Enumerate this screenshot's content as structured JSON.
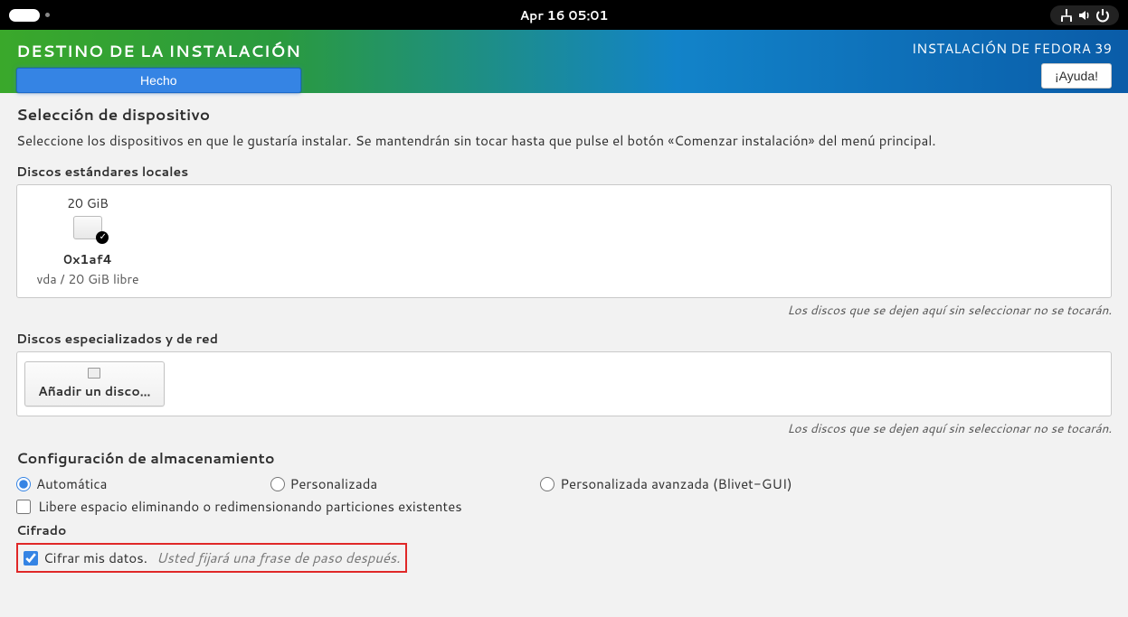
{
  "topbar": {
    "datetime": "Apr 16  05:01"
  },
  "header": {
    "title": "DESTINO DE LA INSTALACIÓN",
    "done_label": "Hecho",
    "product": "INSTALACIÓN DE FEDORA 39",
    "help_label": "¡Ayuda!"
  },
  "device_selection": {
    "title": "Selección de dispositivo",
    "description": "Seleccione los dispositivos en que le gustaría instalar. Se mantendrán sin tocar hasta que pulse el botón «Comenzar instalación» del menú principal."
  },
  "local_disks": {
    "heading": "Discos estándares locales",
    "disk": {
      "size": "20 GiB",
      "name": "0x1af4",
      "subtext": "vda  /  20 GiB libre"
    },
    "hint": "Los discos que se dejen aquí sin seleccionar no se tocarán."
  },
  "special_disks": {
    "heading": "Discos especializados y de red",
    "add_label": "Añadir un disco…",
    "hint": "Los discos que se dejen aquí sin seleccionar no se tocarán."
  },
  "storage_config": {
    "heading": "Configuración de almacenamiento",
    "auto": "Automática",
    "custom": "Personalizada",
    "advanced": "Personalizada avanzada (Blivet-GUI)",
    "reclaim": "Libere espacio eliminando o redimensionando particiones existentes"
  },
  "encryption": {
    "heading": "Cifrado",
    "encrypt_label": "Cifrar mis datos.",
    "note": "Usted fijará una frase de paso después."
  }
}
